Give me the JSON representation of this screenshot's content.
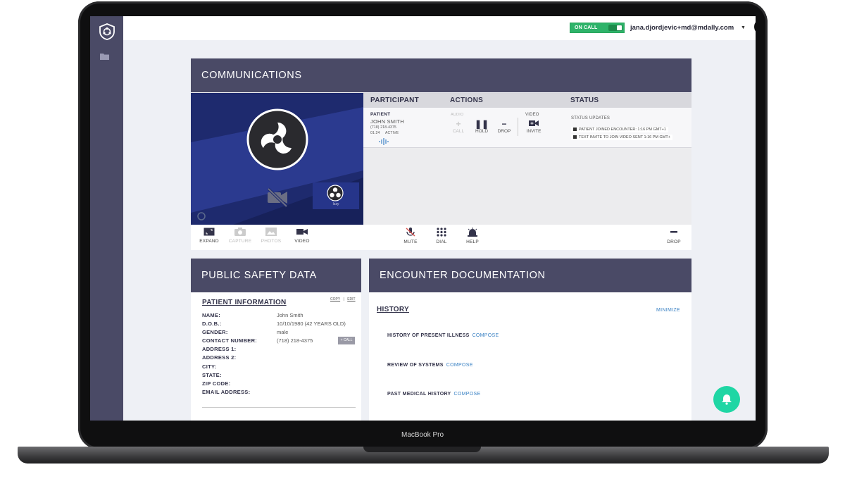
{
  "device": {
    "label": "MacBook Pro"
  },
  "header": {
    "on_call_label": "ON CALL",
    "user_email": "jana.djordjevic+md@mdally.com"
  },
  "communications": {
    "title": "COMMUNICATIONS",
    "mini_participant_label": "Izzy",
    "columns": {
      "participant": "PARTICIPANT",
      "actions": "ACTIONS",
      "status": "STATUS"
    },
    "participant": {
      "role": "PATIENT",
      "name": "JOHN SMITH",
      "phone": "(718) 218-4375",
      "timer": "01:24",
      "state": "ACTIVE"
    },
    "actions": {
      "audio_label": "AUDIO",
      "call_label": "CALL",
      "hold_label": "HOLD",
      "drop_label": "DROP",
      "video_label": "VIDEO",
      "invite_label": "INVITE"
    },
    "status": {
      "updates_title": "STATUS UPDATES",
      "updates": [
        "PATIENT JOINED ENCOUNTER: 1:16 PM GMT+1",
        "TEXT INVITE TO JOIN VIDEO SENT 1:16 PM GMT+"
      ]
    },
    "toolbar": {
      "expand": "EXPAND",
      "capture": "CAPTURE",
      "photos": "PHOTOS",
      "video": "VIDEO",
      "mute": "MUTE",
      "dial": "DIAL",
      "help": "HELP",
      "drop": "DROP"
    }
  },
  "public_safety": {
    "title": "PUBLIC SAFETY DATA",
    "section_title": "PATIENT INFORMATION",
    "copy_label": "COPY",
    "edit_label": "EDIT",
    "call_button": "+ CALL",
    "fields": [
      {
        "label": "NAME:",
        "value": "John Smith"
      },
      {
        "label": "D.O.B.:",
        "value": "10/10/1980 (42 YEARS OLD)"
      },
      {
        "label": "GENDER:",
        "value": "male"
      },
      {
        "label": "CONTACT NUMBER:",
        "value": "(718) 218-4375"
      },
      {
        "label": "ADDRESS 1:",
        "value": ""
      },
      {
        "label": "ADDRESS 2:",
        "value": ""
      },
      {
        "label": "CITY:",
        "value": ""
      },
      {
        "label": "STATE:",
        "value": ""
      },
      {
        "label": "ZIP CODE:",
        "value": ""
      },
      {
        "label": "EMAIL ADDRESS:",
        "value": ""
      }
    ]
  },
  "encounter": {
    "title": "ENCOUNTER DOCUMENTATION",
    "section_title": "HISTORY",
    "minimize_label": "MINIMIZE",
    "compose_label": "COMPOSE",
    "rows": [
      "HISTORY OF PRESENT ILLNESS",
      "REVIEW OF SYSTEMS",
      "PAST MEDICAL HISTORY"
    ]
  },
  "colors": {
    "sidebar": "#4a4a66",
    "panel_header": "#4a4a66",
    "on_call_green": "#2eb36a",
    "link_blue": "#3b82c4",
    "bell_teal": "#1fd6a4",
    "video_bg": "#1e2a6e"
  },
  "icons": [
    "shield-logo-icon",
    "folder-icon",
    "user-avatar-icon",
    "obs-logo-icon",
    "camera-off-icon",
    "expand-icon",
    "capture-icon",
    "photos-icon",
    "video-icon",
    "mute-icon",
    "dial-icon",
    "help-icon",
    "drop-icon",
    "plus-icon",
    "pause-icon",
    "minus-icon",
    "bell-icon"
  ]
}
